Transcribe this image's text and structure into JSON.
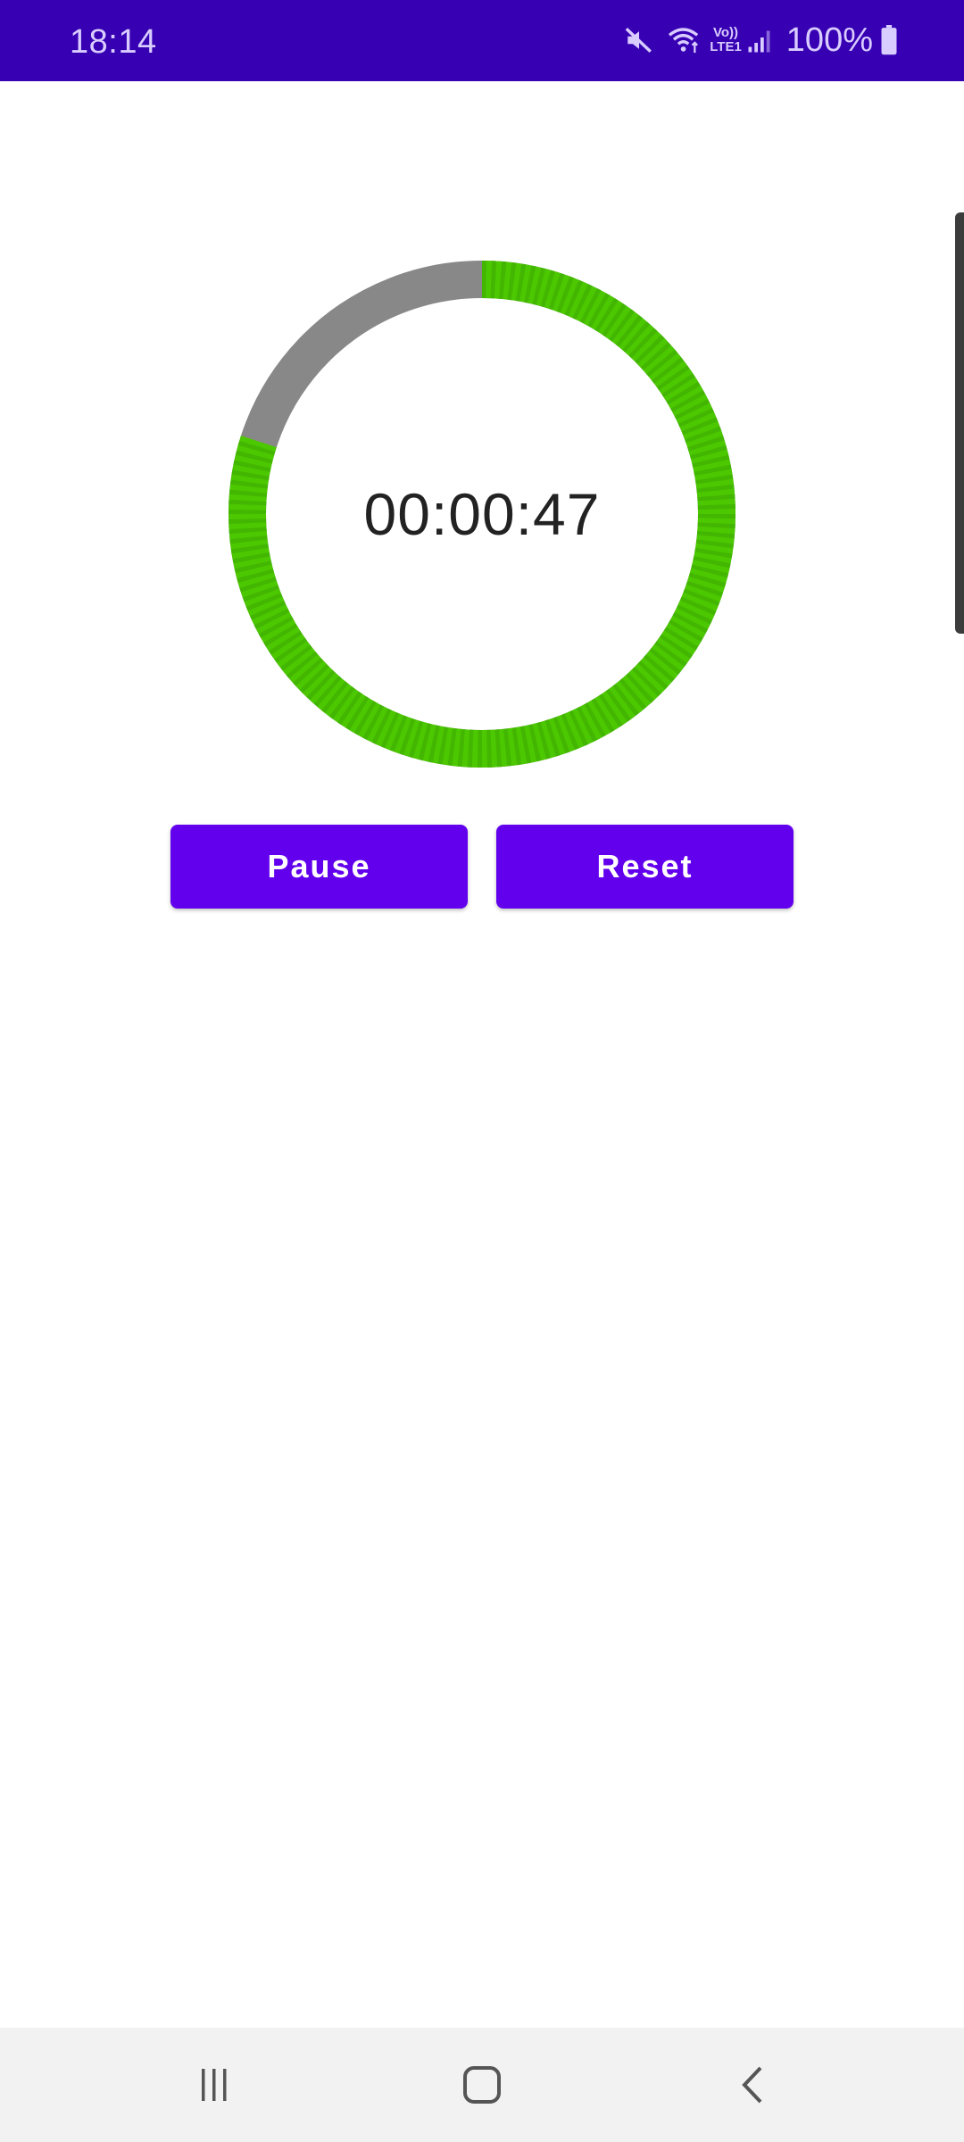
{
  "status_bar": {
    "time": "18:14",
    "battery": "100%",
    "icons": [
      "mute-icon",
      "wifi-icon",
      "volte-icon",
      "signal-icon",
      "battery-icon"
    ],
    "volte_line1": "Vo))",
    "volte_line2": "LTE1"
  },
  "timer": {
    "display": "00:00:47",
    "progress_fraction": 0.8,
    "remaining_color": "#4cc800",
    "elapsed_color": "#888888"
  },
  "buttons": {
    "pause_label": "Pause",
    "reset_label": "Reset",
    "color": "#6200ee"
  },
  "nav_bar": {
    "icons": [
      "recents-icon",
      "home-icon",
      "back-icon"
    ]
  },
  "colors": {
    "status_bar_bg": "#3700b3",
    "accent": "#6200ee"
  }
}
